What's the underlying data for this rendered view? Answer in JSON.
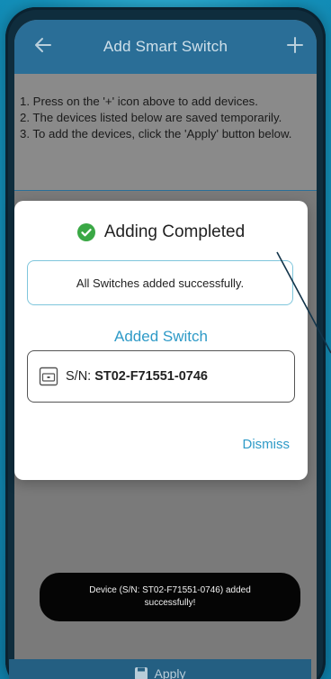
{
  "appbar": {
    "title": "Add Smart Switch",
    "back_icon": "arrow-left-icon",
    "add_icon": "plus-icon"
  },
  "instructions": {
    "line1": "1. Press on the '+' icon above to add devices.",
    "line2": "2. The devices listed below are saved temporarily.",
    "line3": "3. To add the devices, click the 'Apply' button below."
  },
  "dialog": {
    "title": "Adding Completed",
    "status_icon": "check-circle-icon",
    "message": "All Switches added successfully.",
    "section_label": "Added Switch",
    "switch": {
      "icon": "switch-device-icon",
      "sn_label": "S/N:",
      "sn_value": "ST02-F71551-0746"
    },
    "dismiss_label": "Dismiss"
  },
  "toast": {
    "message": "Device (S/N: ST02-F71551-0746) added successfully!"
  },
  "bottombar": {
    "apply_label": "Apply",
    "apply_icon": "save-icon"
  },
  "colors": {
    "appbar": "#2a6e97",
    "accent": "#2e9ac7",
    "success": "#3aa845",
    "toast_bg": "#050505"
  }
}
